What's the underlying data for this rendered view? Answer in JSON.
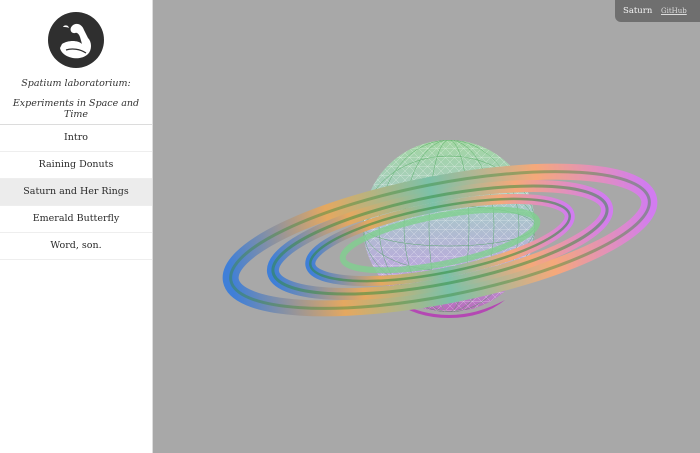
{
  "site": {
    "title_line1": "Spatium laboratorium:",
    "title_line2": "Experiments in Space and Time",
    "logo_icon": "swan-logo-icon"
  },
  "nav": {
    "items": [
      {
        "label": "Intro"
      },
      {
        "label": "Raining Donuts"
      },
      {
        "label": "Saturn and Her Rings",
        "active": true
      },
      {
        "label": "Emerald Butterfly"
      },
      {
        "label": "Word, son."
      }
    ]
  },
  "header": {
    "title": "Saturn",
    "github_link": "GitHub"
  },
  "scene": {
    "subject": "saturn-wireframe-sphere-with-rings",
    "background_color": "#a8a8a8"
  }
}
